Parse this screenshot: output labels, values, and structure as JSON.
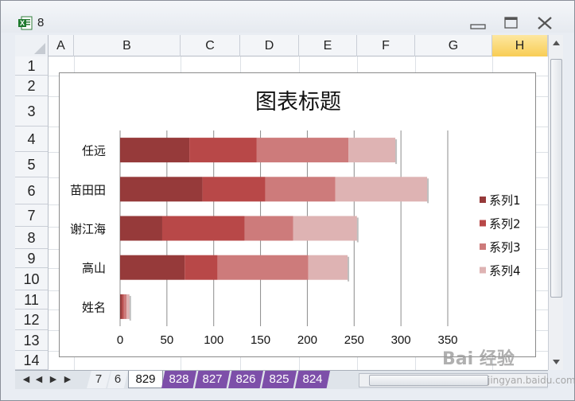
{
  "window": {
    "title": "8",
    "icon": "excel-icon"
  },
  "columns": [
    {
      "label": "A"
    },
    {
      "label": "B"
    },
    {
      "label": "C"
    },
    {
      "label": "D"
    },
    {
      "label": "E"
    },
    {
      "label": "F"
    },
    {
      "label": "G"
    },
    {
      "label": "H"
    }
  ],
  "active_column": "H",
  "rows": [
    "1",
    "2",
    "3",
    "4",
    "5",
    "6",
    "7",
    "8",
    "9",
    "10",
    "11",
    "12",
    "13",
    "14"
  ],
  "sheet_tabs": [
    "7",
    "6",
    "829",
    "828",
    "827",
    "826",
    "825",
    "824"
  ],
  "active_sheet": "829",
  "watermark": {
    "text": "Bai 经验",
    "sub": "jingyan.baidu.com"
  },
  "chart_data": {
    "type": "bar",
    "orientation": "horizontal",
    "stacked": true,
    "title": "图表标题",
    "categories": [
      "任远",
      "苗田田",
      "谢江海",
      "高山",
      "姓名"
    ],
    "series": [
      {
        "name": "系列1",
        "color": "#963a3a",
        "values": [
          74,
          88,
          45,
          69,
          2
        ]
      },
      {
        "name": "系列2",
        "color": "#b84848",
        "values": [
          72,
          67,
          88,
          35,
          2
        ]
      },
      {
        "name": "系列3",
        "color": "#cd7b7b",
        "values": [
          98,
          75,
          52,
          97,
          3
        ]
      },
      {
        "name": "系列4",
        "color": "#deb3b3",
        "values": [
          50,
          98,
          68,
          42,
          3
        ]
      }
    ],
    "x_ticks": [
      "0",
      "50",
      "100",
      "150",
      "200",
      "250",
      "300",
      "350"
    ],
    "xlim": [
      0,
      350
    ],
    "grid": "vertical",
    "legend": "right"
  }
}
